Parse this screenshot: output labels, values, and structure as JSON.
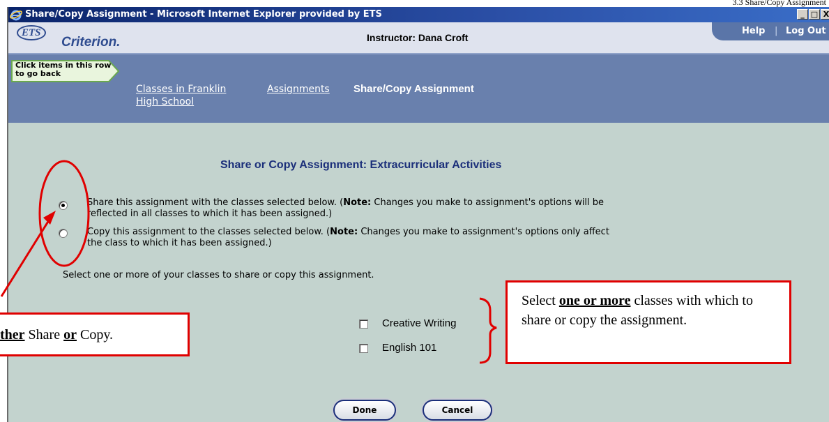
{
  "doc_header": "3.3 Share/Copy Assignment",
  "window": {
    "title": "Share/Copy Assignment - Microsoft Internet Explorer provided by ETS",
    "controls": {
      "minimize": "_",
      "maximize": "□",
      "close": "X"
    }
  },
  "header": {
    "logo_mark": "ETS",
    "logo_text": "Criterion.",
    "instructor": "Instructor: Dana Croft",
    "help_label": "Help",
    "separator": "|",
    "logout_label": "Log Out"
  },
  "breadcrumb": {
    "hint": "Click items in this row to go back",
    "items": [
      {
        "label_line1": "Classes in Franklin",
        "label_line2": "High School"
      },
      {
        "label": "Assignments"
      }
    ],
    "current": "Share/Copy Assignment"
  },
  "main": {
    "heading": "Share or Copy Assignment: Extracurricular Activities",
    "options": [
      {
        "selected": true,
        "line1_pre": "Share this assignment with the classes selected below. (",
        "note": "Note:",
        "line1_post": " Changes you make to assignment's options will be",
        "line2": "reflected in all classes to which it has been assigned.)"
      },
      {
        "selected": false,
        "line1_pre": "Copy this assignment to the classes selected below. (",
        "note": "Note:",
        "line1_post": " Changes you make to assignment's options only affect",
        "line2": "the class to which it has been assigned.)"
      }
    ],
    "instruction": "Select one or more of your classes to share or copy this assignment.",
    "classes": [
      {
        "name": "Creative Writing",
        "checked": false
      },
      {
        "name": "English 101",
        "checked": false
      }
    ],
    "done_label": "Done",
    "cancel_label": "Cancel"
  },
  "callouts": {
    "left": {
      "part1": "ther",
      "part2": " Share ",
      "part3": "or",
      "part4": " Copy."
    },
    "right": {
      "part1": "Select ",
      "part2": "one or more",
      "part3": " classes with which to share or copy the assignment."
    }
  },
  "colors": {
    "annotation_red": "#e00000",
    "heading_blue": "#1b2f7a",
    "content_bg": "#c3d3ce",
    "breadcrumb_bg": "#6980ad"
  }
}
